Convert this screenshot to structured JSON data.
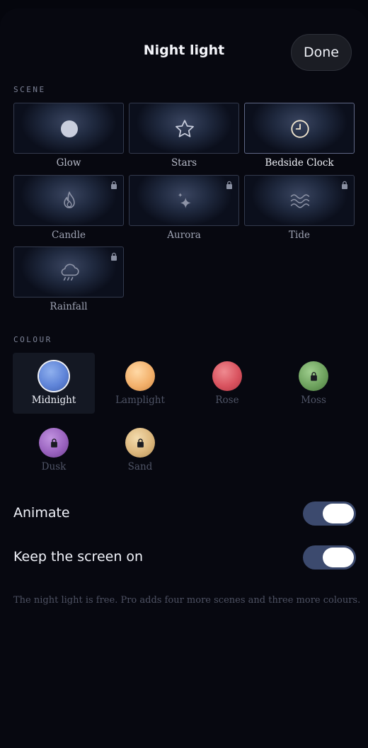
{
  "header": {
    "title": "Night light",
    "done_label": "Done"
  },
  "scene": {
    "section_label": "SCENE",
    "items": [
      {
        "label": "Glow",
        "icon": "circle-icon",
        "locked": false,
        "selected": false
      },
      {
        "label": "Stars",
        "icon": "star-icon",
        "locked": false,
        "selected": false
      },
      {
        "label": "Bedside Clock",
        "icon": "clock-icon",
        "locked": false,
        "selected": true
      },
      {
        "label": "Candle",
        "icon": "flame-icon",
        "locked": true,
        "selected": false
      },
      {
        "label": "Aurora",
        "icon": "sparkle-icon",
        "locked": true,
        "selected": false
      },
      {
        "label": "Tide",
        "icon": "waves-icon",
        "locked": true,
        "selected": false
      },
      {
        "label": "Rainfall",
        "icon": "rain-cloud-icon",
        "locked": true,
        "selected": false
      }
    ]
  },
  "colour": {
    "section_label": "COLOUR",
    "items": [
      {
        "label": "Midnight",
        "color": "#5f84d8",
        "locked": false,
        "selected": true
      },
      {
        "label": "Lamplight",
        "color": "#f3b16c",
        "locked": false,
        "selected": false
      },
      {
        "label": "Rose",
        "color": "#d9535f",
        "locked": false,
        "selected": false
      },
      {
        "label": "Moss",
        "color": "#6fa35f",
        "locked": true,
        "selected": false
      },
      {
        "label": "Dusk",
        "color": "#9a63bf",
        "locked": true,
        "selected": false
      },
      {
        "label": "Sand",
        "color": "#dcb77d",
        "locked": true,
        "selected": false
      }
    ]
  },
  "settings": {
    "animate_label": "Animate",
    "animate_on": true,
    "keep_screen_label": "Keep the screen on",
    "keep_screen_on": true
  },
  "footnote": "The night light is free. Pro adds four more scenes and three more colours.",
  "colors": {
    "accent": "#3c4a6e",
    "background": "#070810"
  }
}
